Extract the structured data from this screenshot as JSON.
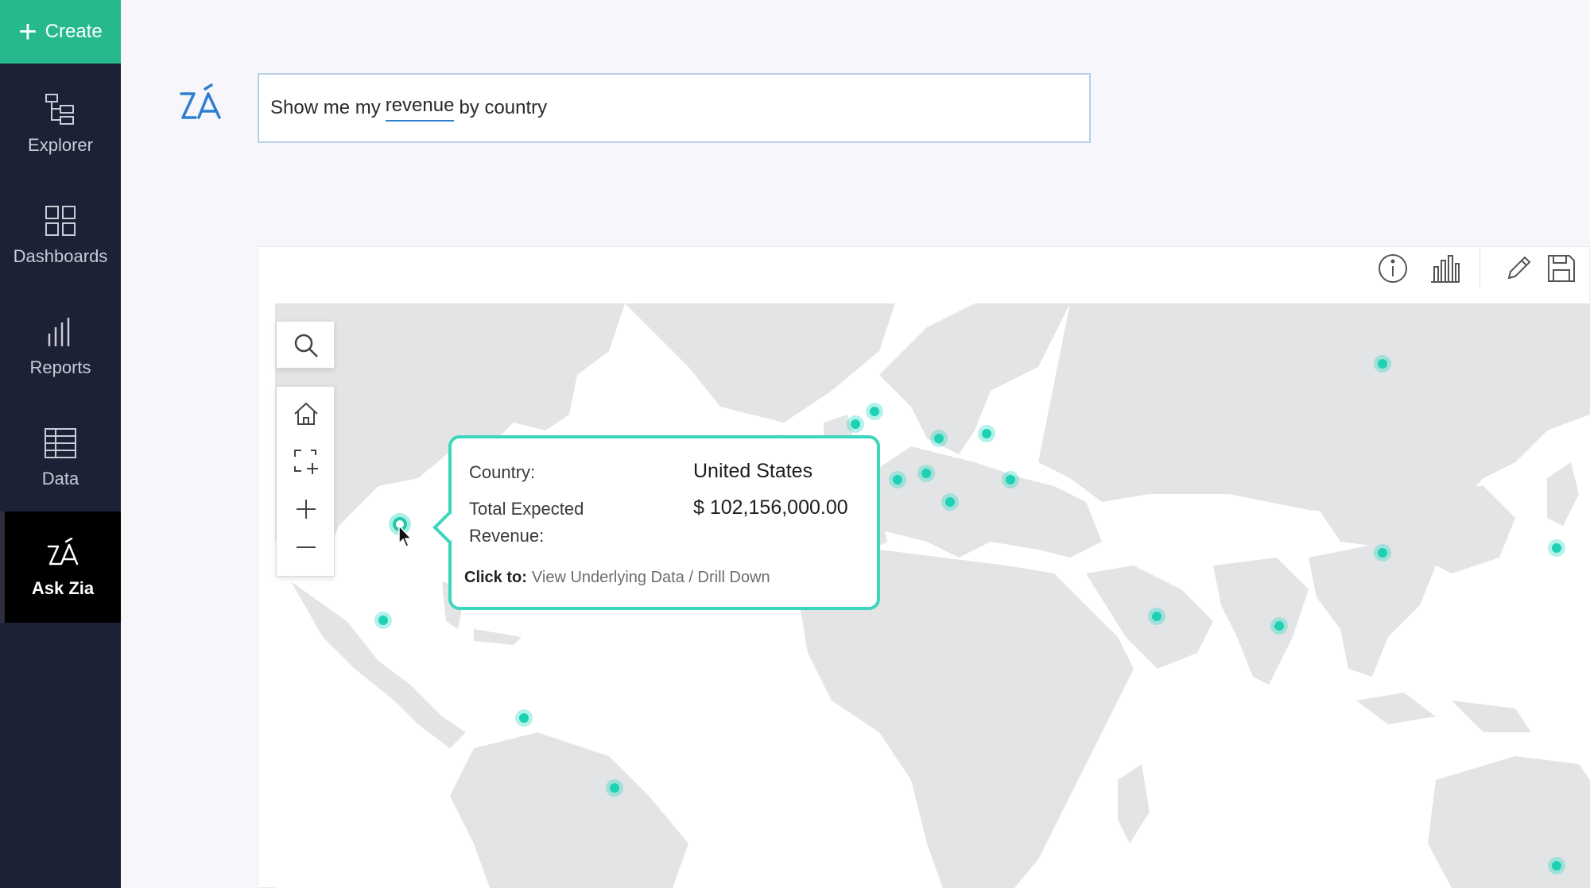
{
  "sidebar": {
    "create_label": "Create",
    "items": [
      {
        "label": "Explorer",
        "icon": "explorer-icon"
      },
      {
        "label": "Dashboards",
        "icon": "dashboards-icon"
      },
      {
        "label": "Reports",
        "icon": "reports-icon"
      },
      {
        "label": "Data",
        "icon": "data-icon"
      },
      {
        "label": "Ask Zia",
        "icon": "zia-icon",
        "active": true
      }
    ]
  },
  "query": {
    "before": "Show me my",
    "keyword": "revenue",
    "after": "by country"
  },
  "toolbar": {
    "icons": [
      "info-icon",
      "chart-type-icon",
      "edit-icon",
      "save-icon"
    ]
  },
  "map_controls": [
    "search-icon",
    "home-icon",
    "zoom-to-area-icon",
    "zoom-in-icon",
    "zoom-out-icon"
  ],
  "tooltip": {
    "country_label": "Country:",
    "country_value": "United States",
    "revenue_label_1": "Total Expected",
    "revenue_label_2": "Revenue:",
    "revenue_value": "$ 102,156,000.00",
    "click_label": "Click to:",
    "click_actions": "View Underlying Data / Drill Down"
  },
  "colors": {
    "sidebar_bg": "#1c2135",
    "create_bg": "#26b98d",
    "accent_teal": "#3cd6bc",
    "land": "#e2e4e5"
  }
}
